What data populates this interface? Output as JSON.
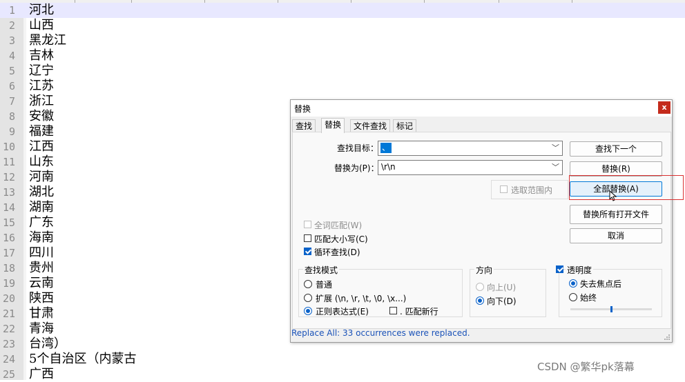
{
  "editor": {
    "lines": [
      {
        "n": "1",
        "text": "河北"
      },
      {
        "n": "2",
        "text": "山西"
      },
      {
        "n": "3",
        "text": "黑龙江"
      },
      {
        "n": "4",
        "text": "吉林"
      },
      {
        "n": "5",
        "text": "辽宁"
      },
      {
        "n": "6",
        "text": "江苏"
      },
      {
        "n": "7",
        "text": "浙江"
      },
      {
        "n": "8",
        "text": "安徽"
      },
      {
        "n": "9",
        "text": "福建"
      },
      {
        "n": "10",
        "text": "江西"
      },
      {
        "n": "11",
        "text": "山东"
      },
      {
        "n": "12",
        "text": "河南"
      },
      {
        "n": "13",
        "text": "湖北"
      },
      {
        "n": "14",
        "text": "湖南"
      },
      {
        "n": "15",
        "text": "广东"
      },
      {
        "n": "16",
        "text": "海南"
      },
      {
        "n": "17",
        "text": "四川"
      },
      {
        "n": "18",
        "text": "贵州"
      },
      {
        "n": "19",
        "text": "云南"
      },
      {
        "n": "20",
        "text": "陕西"
      },
      {
        "n": "21",
        "text": "甘肃"
      },
      {
        "n": "22",
        "text": "青海"
      },
      {
        "n": "23",
        "text": "台湾）"
      },
      {
        "n": "24",
        "text": "5个自治区（内蒙古"
      },
      {
        "n": "25",
        "text": "广西"
      }
    ]
  },
  "dialog": {
    "title": "替换",
    "close_label": "x",
    "tabs": [
      {
        "label": "查找"
      },
      {
        "label": "替换"
      },
      {
        "label": "文件查找"
      },
      {
        "label": "标记"
      }
    ],
    "find_label": "查找目标：",
    "find_value": "、",
    "replace_label": "替换为(P)：",
    "replace_value": "\\r\\n",
    "in_selection_label": "选取范围内",
    "buttons": {
      "find_next": "查找下一个",
      "replace": "替换(R)",
      "replace_all": "全部替换(A)",
      "replace_all_open": "替换所有打开文件",
      "cancel": "取消"
    },
    "options": {
      "whole_word": "全词匹配(W)",
      "match_case": "匹配大小写(C)",
      "wrap_around": "循环查找(D)"
    },
    "search_mode": {
      "title": "查找模式",
      "normal": "普通",
      "extended": "扩展 (\\n, \\r, \\t, \\0, \\x...)",
      "regex": "正则表达式(E)",
      "dot_newline": ". 匹配新行"
    },
    "direction": {
      "title": "方向",
      "up": "向上(U)",
      "down": "向下(D)"
    },
    "transparency": {
      "title": "透明度",
      "on_lose_focus": "失去焦点后",
      "always": "始终",
      "slider_level": 0.5
    },
    "status": "Replace All: 33 occurrences were replaced."
  },
  "watermark": "CSDN @繁华pk落幕",
  "colors": {
    "accent": "#0a62c9",
    "status_text": "#1a52b8",
    "highlight": "#d93030",
    "current_line": "#e8e8ff"
  }
}
